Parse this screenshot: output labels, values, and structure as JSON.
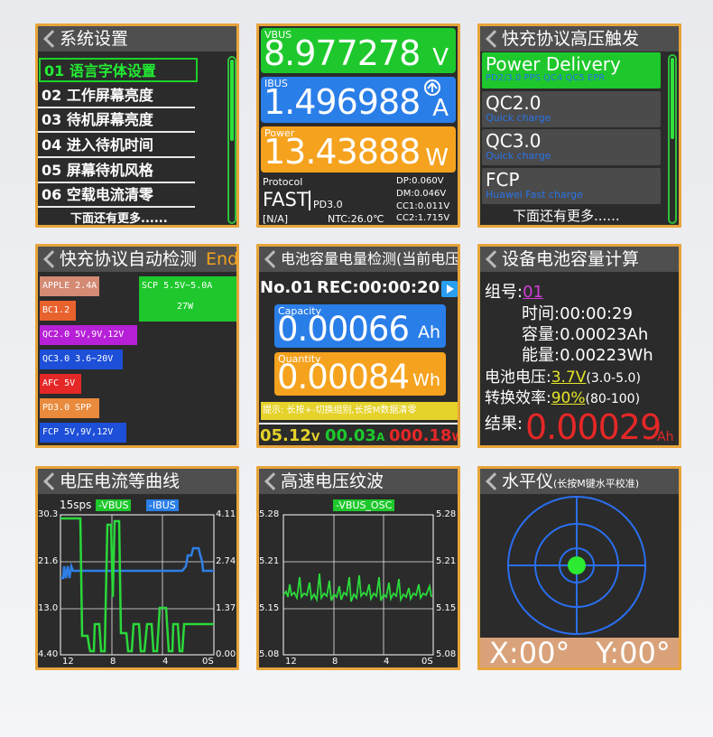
{
  "s1": {
    "title": "系统设置",
    "items": [
      "01 语言字体设置",
      "02 工作屏幕亮度",
      "03 待机屏幕亮度",
      "04 进入待机时间",
      "05 屏幕待机风格",
      "06 空载电流清零"
    ],
    "more": "下面还有更多......"
  },
  "s2": {
    "vbus_lbl": "VBUS",
    "vbus": "8.977278",
    "vbus_u": "V",
    "ibus_lbl": "IBUS",
    "ibus": "1.496988",
    "ibus_u": "A",
    "pwr_lbl": "Power",
    "pwr": "13.43888",
    "pwr_u": "W",
    "proto_lbl": "Protocol",
    "proto": "FAST",
    "pd": "PD3.0",
    "na": "[N/A]",
    "ntc": "NTC:26.0℃",
    "dp": "DP:0.060V",
    "dm": "DM:0.046V",
    "cc1": "CC1:0.011V",
    "cc2": "CC2:1.715V"
  },
  "s3": {
    "title": "快充协议高压触发",
    "pd_name": "Power Delivery",
    "pd_sub": "PD2/3.0   PPS   QC4   QC5   EPR",
    "qc2": "QC2.0",
    "qc2_sub": "Quick charge",
    "qc3": "QC3.0",
    "qc3_sub": "Quick charge",
    "fcp": "FCP",
    "fcp_sub": "Huawei Fast charge",
    "more": "下面还有更多......"
  },
  "s4": {
    "title": "快充协议自动检测",
    "end": "End",
    "tags": [
      "APPLE 2.4A",
      "BC1.2",
      "QC2.0 5V,9V,12V",
      "QC3.0 3.6~20V",
      "AFC 5V",
      "PD3.0 SPP",
      "FCP 5V,9V,12V"
    ],
    "scp1": "SCP  5.5V~5.0A",
    "scp2": "27W"
  },
  "s5": {
    "title": "电池容量电量检测(当前电压)",
    "no": "No.01",
    "rec": "REC:00:00:20",
    "cap_lbl": "Capacity",
    "cap": "0.00066",
    "cap_u": "Ah",
    "qty_lbl": "Quantity",
    "qty": "0.00084",
    "qty_u": "Wh",
    "tip": "提示: 长按+-切换组别,长按M数据清零",
    "v": "05.12",
    "v_u": "V",
    "a": "00.03",
    "a_u": "A",
    "w": "000.18",
    "w_u": "W"
  },
  "s6": {
    "title": "设备电池容量计算",
    "grp_lbl": "组号:",
    "grp": "01",
    "time_lbl": "时间:",
    "time": "00:00:29",
    "cap_lbl": "容量:",
    "cap": "0.00023Ah",
    "en_lbl": "能量:",
    "en": "0.00223Wh",
    "bv_lbl": "电池电压:",
    "bv": "3.7V",
    "bv_rng": "(3.0-5.0)",
    "eff_lbl": "转换效率:",
    "eff": "90%",
    "eff_rng": "(80-100)",
    "res_lbl": "结果:",
    "res": "0.00029",
    "res_u": "Ah"
  },
  "s7": {
    "title": "电压电流等曲线",
    "sps": "15sps",
    "vbus": "-VBUS",
    "ibus": "-IBUS",
    "yl": [
      "30.3",
      "21.6",
      "13.0",
      "4.40"
    ],
    "yr": [
      "4.11",
      "2.74",
      "1.37",
      "0.00"
    ],
    "xl": [
      "12",
      "8",
      "4",
      "0S"
    ]
  },
  "s8": {
    "title": "高速电压纹波",
    "legend": "-VBUS_OSC",
    "yl": [
      "5.28",
      "5.21",
      "5.15",
      "5.08"
    ],
    "yr": [
      "5.28",
      "5.21",
      "5.15",
      "5.08"
    ],
    "xl": [
      "12",
      "8",
      "4",
      "0S"
    ]
  },
  "s9": {
    "title": "水平仪",
    "sub": "(长按M键水平校准)",
    "x": "X:00°",
    "y": "Y:00°"
  },
  "colors": {
    "border": "#e7a43b",
    "green": "#2bd83a",
    "blue": "#2f7fe6",
    "orange": "#f5a21e",
    "red": "#e02424"
  }
}
